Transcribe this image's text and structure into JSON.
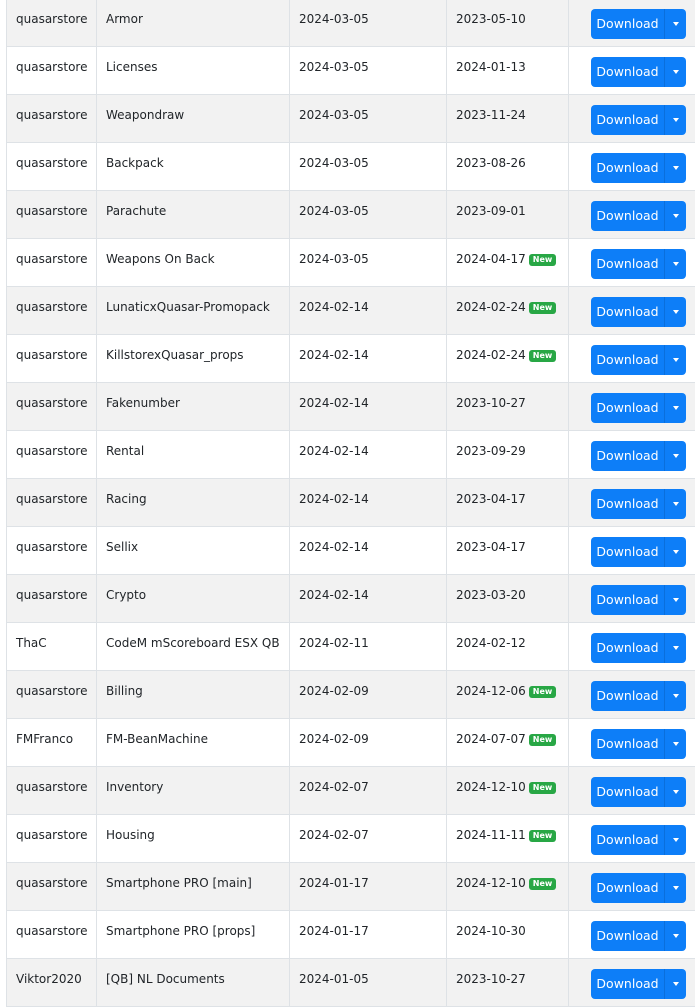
{
  "download_label": "Download",
  "new_badge_label": "New",
  "colors": {
    "button": "#0d7ef8",
    "badge": "#28a745",
    "stripe": "#f2f2f2"
  },
  "rows": [
    {
      "author": "quasarstore",
      "name": "Armor",
      "released": "2024-03-05",
      "updated": "2023-05-10",
      "is_new": false
    },
    {
      "author": "quasarstore",
      "name": "Licenses",
      "released": "2024-03-05",
      "updated": "2024-01-13",
      "is_new": false
    },
    {
      "author": "quasarstore",
      "name": "Weapondraw",
      "released": "2024-03-05",
      "updated": "2023-11-24",
      "is_new": false
    },
    {
      "author": "quasarstore",
      "name": "Backpack",
      "released": "2024-03-05",
      "updated": "2023-08-26",
      "is_new": false
    },
    {
      "author": "quasarstore",
      "name": "Parachute",
      "released": "2024-03-05",
      "updated": "2023-09-01",
      "is_new": false
    },
    {
      "author": "quasarstore",
      "name": "Weapons On Back",
      "released": "2024-03-05",
      "updated": "2024-04-17",
      "is_new": true
    },
    {
      "author": "quasarstore",
      "name": "LunaticxQuasar-Promopack",
      "released": "2024-02-14",
      "updated": "2024-02-24",
      "is_new": true
    },
    {
      "author": "quasarstore",
      "name": "KillstorexQuasar_props",
      "released": "2024-02-14",
      "updated": "2024-02-24",
      "is_new": true
    },
    {
      "author": "quasarstore",
      "name": "Fakenumber",
      "released": "2024-02-14",
      "updated": "2023-10-27",
      "is_new": false
    },
    {
      "author": "quasarstore",
      "name": "Rental",
      "released": "2024-02-14",
      "updated": "2023-09-29",
      "is_new": false
    },
    {
      "author": "quasarstore",
      "name": "Racing",
      "released": "2024-02-14",
      "updated": "2023-04-17",
      "is_new": false
    },
    {
      "author": "quasarstore",
      "name": "Sellix",
      "released": "2024-02-14",
      "updated": "2023-04-17",
      "is_new": false
    },
    {
      "author": "quasarstore",
      "name": "Crypto",
      "released": "2024-02-14",
      "updated": "2023-03-20",
      "is_new": false
    },
    {
      "author": "ThaC",
      "name": "CodeM mScoreboard ESX QB",
      "released": "2024-02-11",
      "updated": "2024-02-12",
      "is_new": false
    },
    {
      "author": "quasarstore",
      "name": "Billing",
      "released": "2024-02-09",
      "updated": "2024-12-06",
      "is_new": true
    },
    {
      "author": "FMFranco",
      "name": "FM-BeanMachine",
      "released": "2024-02-09",
      "updated": "2024-07-07",
      "is_new": true
    },
    {
      "author": "quasarstore",
      "name": "Inventory",
      "released": "2024-02-07",
      "updated": "2024-12-10",
      "is_new": true
    },
    {
      "author": "quasarstore",
      "name": "Housing",
      "released": "2024-02-07",
      "updated": "2024-11-11",
      "is_new": true
    },
    {
      "author": "quasarstore",
      "name": "Smartphone PRO [main]",
      "released": "2024-01-17",
      "updated": "2024-12-10",
      "is_new": true
    },
    {
      "author": "quasarstore",
      "name": "Smartphone PRO [props]",
      "released": "2024-01-17",
      "updated": "2024-10-30",
      "is_new": false
    },
    {
      "author": "Viktor2020",
      "name": "[QB] NL Documents",
      "released": "2024-01-05",
      "updated": "2023-10-27",
      "is_new": false
    }
  ]
}
